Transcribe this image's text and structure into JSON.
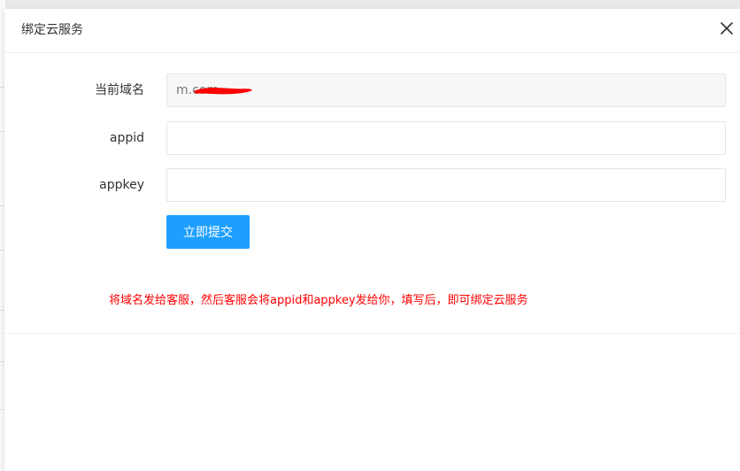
{
  "dialog": {
    "title": "绑定云服务",
    "close_icon": "close-icon"
  },
  "form": {
    "domain": {
      "label": "当前域名",
      "value": "m.com"
    },
    "appid": {
      "label": "appid",
      "value": "",
      "placeholder": ""
    },
    "appkey": {
      "label": "appkey",
      "value": "",
      "placeholder": ""
    },
    "submit_label": "立即提交"
  },
  "hint": "将域名发给客服，然后客服会将appid和appkey发给你，填写后，即可绑定云服务",
  "colors": {
    "primary": "#1e9fff",
    "hint": "#ff0000",
    "redaction": "#ff0000"
  }
}
